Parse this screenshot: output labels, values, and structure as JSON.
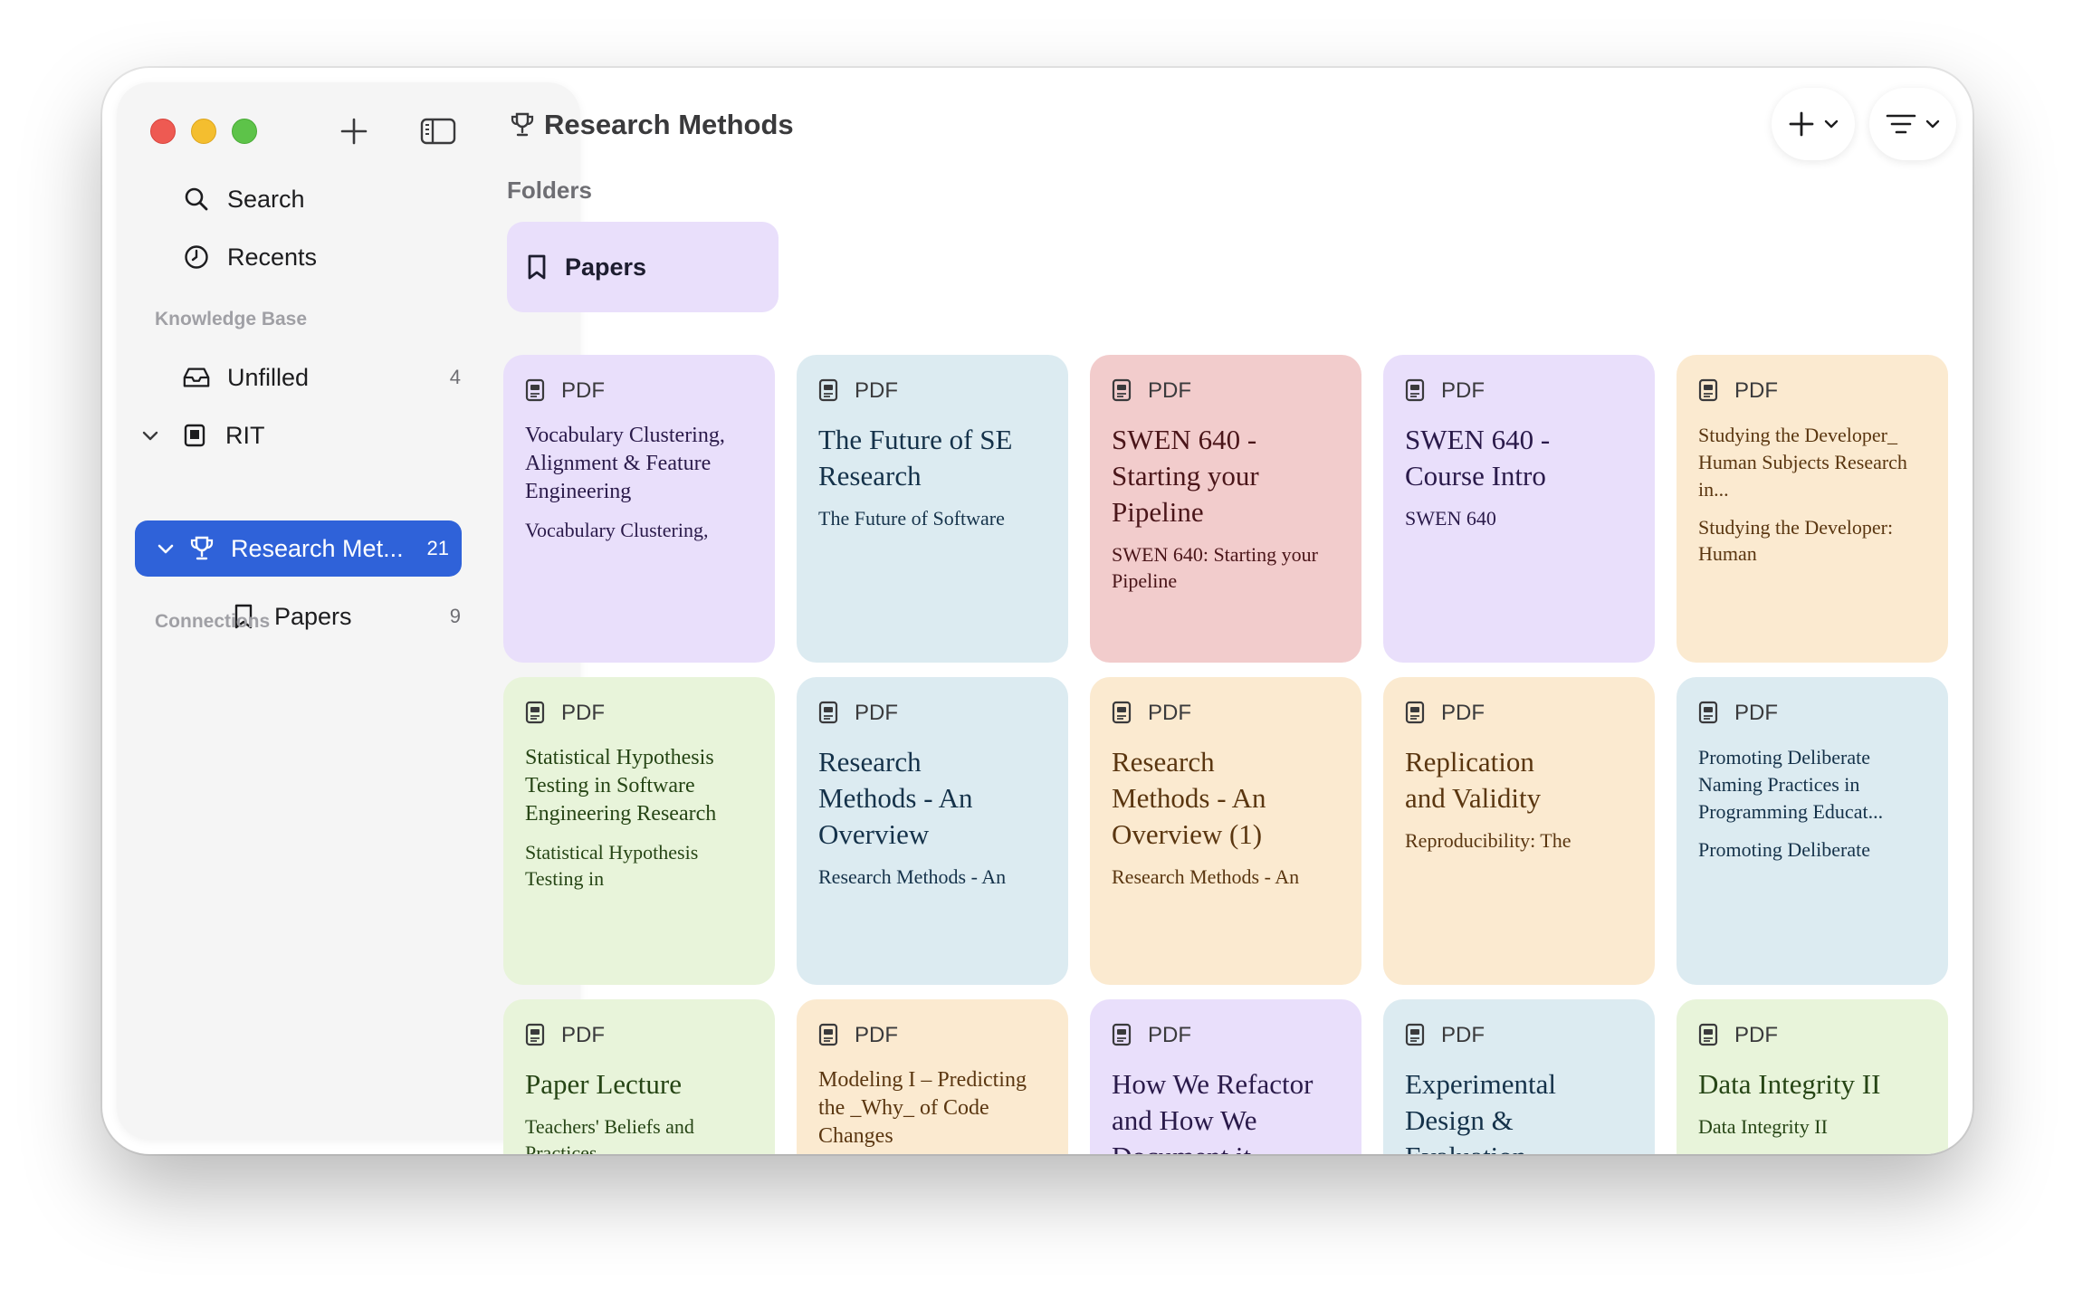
{
  "app": {
    "window_title": "Research Methods",
    "title_icon": "trophy-icon"
  },
  "sidebar": {
    "new_button_icon": "plus-icon",
    "toggle_icon": "sidebar-toggle-icon",
    "search_label": "Search",
    "recents_label": "Recents",
    "knowledge_base_heading": "Knowledge Base",
    "unfilled": {
      "label": "Unfilled",
      "count": "4"
    },
    "rit": {
      "label": "RIT"
    },
    "research_methods": {
      "label": "Research Met...",
      "count": "21"
    },
    "papers": {
      "label": "Papers",
      "count": "9"
    },
    "connections_heading": "Connections"
  },
  "toolbar": {
    "add_menu_icon": "plus-icon",
    "sort_menu_icon": "sort-lines-icon"
  },
  "main": {
    "folders_heading": "Folders",
    "folders": [
      {
        "name": "Papers",
        "icon": "bookmark-icon"
      }
    ],
    "documents": [
      {
        "type": "PDF",
        "title": "Vocabulary Clustering, Alignment & Feature Engineering",
        "subtitle": "Vocabulary Clustering,",
        "color": "#e9dffb"
      },
      {
        "type": "PDF",
        "title": "The Future of SE Research",
        "subtitle": "The Future of Software",
        "color": "#dcebf1"
      },
      {
        "type": "PDF",
        "title": "SWEN 640 - Starting your Pipeline",
        "subtitle": "SWEN 640: Starting your Pipeline",
        "color": "#f2cccc"
      },
      {
        "type": "PDF",
        "title": "SWEN 640 - Course Intro",
        "subtitle": "SWEN 640",
        "color": "#e9dffb"
      },
      {
        "type": "PDF",
        "title": "Studying the Developer_ Human Subjects Research in...",
        "subtitle": "Studying the Developer: Human",
        "color": "#fbead0"
      },
      {
        "type": "PDF",
        "title": "Statistical Hypothesis Testing in Software Engineering Research",
        "subtitle": "Statistical Hypothesis Testing in",
        "color": "#e8f4da"
      },
      {
        "type": "PDF",
        "title": "Research Methods - An Overview",
        "subtitle": "Research Methods - An",
        "color": "#dcebf1"
      },
      {
        "type": "PDF",
        "title": "Research Methods - An Overview (1)",
        "subtitle": "Research Methods - An",
        "color": "#fbead0"
      },
      {
        "type": "PDF",
        "title": "Replication and Validity",
        "subtitle": "Reproducibility: The",
        "color": "#fbead0"
      },
      {
        "type": "PDF",
        "title": "Promoting Deliberate Naming Practices in Programming Educat...",
        "subtitle": "Promoting Deliberate",
        "color": "#dcebf1"
      },
      {
        "type": "PDF",
        "title": "Paper Lecture",
        "subtitle": "Teachers' Beliefs and Practices",
        "color": "#e8f4da"
      },
      {
        "type": "PDF",
        "title": "Modeling I – Predicting the _Why_ of Code Changes",
        "subtitle": "",
        "color": "#fbead0"
      },
      {
        "type": "PDF",
        "title": "How We Refactor and How We Document it",
        "subtitle": "",
        "color": "#e9dffb"
      },
      {
        "type": "PDF",
        "title": "Experimental Design & Evaluation",
        "subtitle": "",
        "color": "#dcebf1"
      },
      {
        "type": "PDF",
        "title": "Data Integrity II",
        "subtitle": "Data Integrity II",
        "color": "#e8f4da"
      }
    ]
  }
}
